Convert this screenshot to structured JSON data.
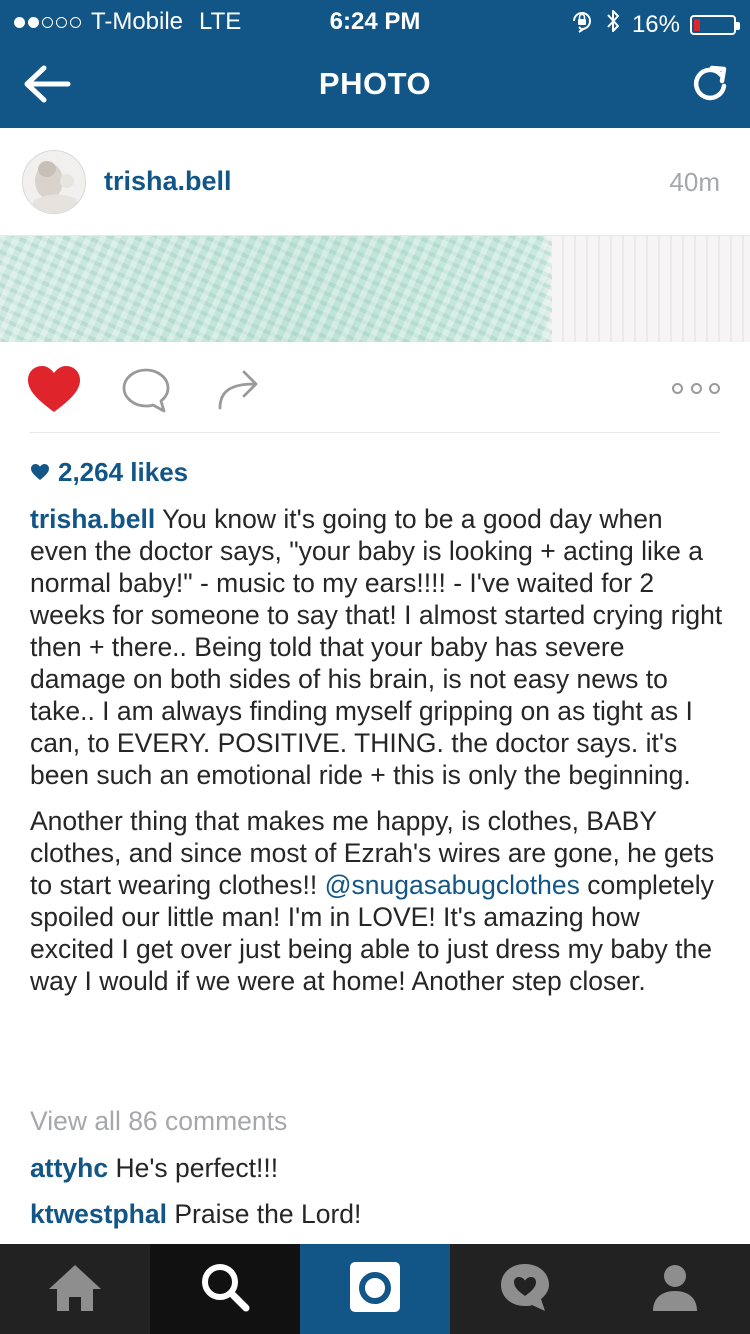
{
  "status_bar": {
    "carrier": "T-Mobile",
    "network": "LTE",
    "time": "6:24 PM",
    "battery": "16%",
    "battery_level": 0.16,
    "signal_bars_filled": 2,
    "signal_bars_total": 5,
    "icons": [
      "orientation-lock-icon",
      "bluetooth-icon",
      "battery-icon"
    ]
  },
  "nav": {
    "title": "PHOTO",
    "back_icon": "arrow-left-icon",
    "refresh_icon": "refresh-icon"
  },
  "post": {
    "username": "trisha.bell",
    "time_ago": "40m",
    "likes": "2,264 likes",
    "caption_author": "trisha.bell",
    "caption_p1": "You know it's going to be a good day when even the doctor says, \"your baby is looking + acting like a normal baby!\" - music to my ears!!!! - I've waited for 2 weeks for someone to say that! I almost started crying right then + there.. Being told that your baby has severe damage on both sides of his brain,  is not easy news to take.. I am always finding myself gripping on as tight as I can,  to EVERY. POSITIVE. THING.  the doctor says.  it's been such an emotional ride + this is only the beginning.",
    "caption_p2_before": "Another thing that makes me happy,  is clothes, BABY clothes,  and since most of Ezrah's wires are gone, he gets to start wearing clothes!!",
    "caption_p2_mention": "@snugasabugclothes",
    "caption_p2_after": "completely spoiled our little man! I'm in LOVE! It's amazing how excited I get over just being able to just dress my baby the way I would if we were at home! Another step closer.",
    "view_all": "View all 86 comments",
    "comments": [
      {
        "user": "attyhc",
        "text": "He's perfect!!!"
      },
      {
        "user": "ktwestphal",
        "text": "Praise the Lord!"
      }
    ],
    "liked": true
  },
  "colors": {
    "brand_blue": "#125688",
    "like_red": "#e0242c",
    "muted_gray": "#a5a7aa",
    "tabbar": "#222222"
  },
  "tabbar": {
    "tabs": [
      "home-icon",
      "search-icon",
      "camera-icon",
      "activity-icon",
      "profile-icon"
    ],
    "active": "camera-icon"
  }
}
